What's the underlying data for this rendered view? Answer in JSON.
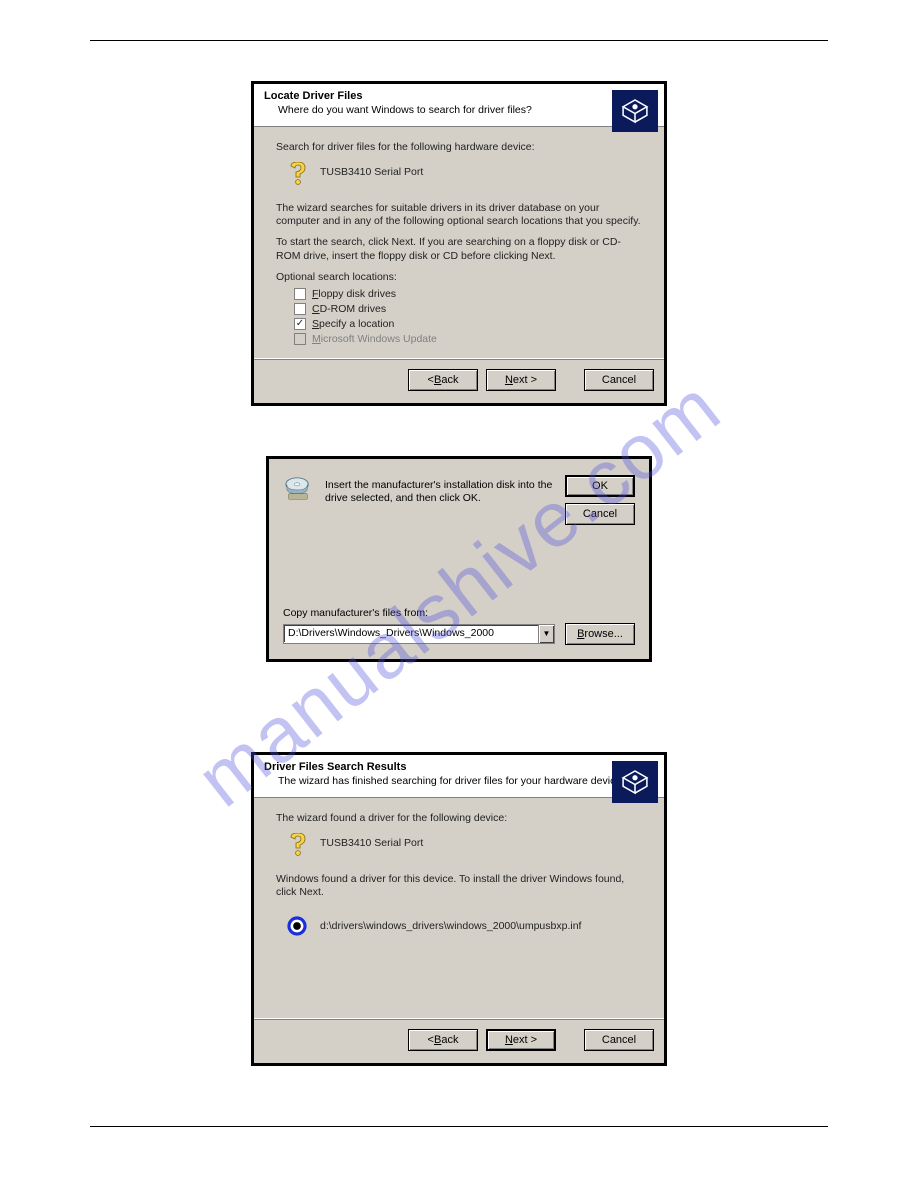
{
  "watermark": "manualshive.com",
  "dialog1": {
    "title": "Locate Driver Files",
    "subtitle": "Where do you want Windows to search for driver files?",
    "search_prompt": "Search for driver files for the following hardware device:",
    "device_name": "TUSB3410 Serial Port",
    "desc1": "The wizard searches for suitable drivers in its driver database on your computer and in any of the following optional search locations that you specify.",
    "desc2": "To start the search, click Next. If you are searching on a floppy disk or CD-ROM drive, insert the floppy disk or CD before clicking Next.",
    "opt_label": "Optional search locations:",
    "checkboxes": [
      {
        "text_pre": "",
        "u": "F",
        "text_post": "loppy disk drives",
        "checked": false,
        "disabled": false
      },
      {
        "text_pre": "",
        "u": "C",
        "text_post": "D-ROM drives",
        "checked": false,
        "disabled": false
      },
      {
        "text_pre": "",
        "u": "S",
        "text_post": "pecify a location",
        "checked": true,
        "disabled": false
      },
      {
        "text_pre": "",
        "u": "M",
        "text_post": "icrosoft Windows Update",
        "checked": false,
        "disabled": true
      }
    ],
    "buttons": {
      "back_u": "B",
      "back_rest": "ack",
      "back_lt": "< ",
      "next_u": "N",
      "next_rest": "ext >",
      "cancel": "Cancel"
    }
  },
  "dialog2": {
    "message": "Insert the manufacturer's installation disk into the drive selected, and then click OK.",
    "ok": "OK",
    "cancel": "Cancel",
    "copy_label_pre": "",
    "copy_label_u": "C",
    "copy_label_post": "opy manufacturer's files from:",
    "path": "D:\\Drivers\\Windows_Drivers\\Windows_2000",
    "browse_u": "B",
    "browse_rest": "rowse..."
  },
  "dialog3": {
    "title": "Driver Files Search Results",
    "subtitle": "The wizard has finished searching for driver files for your hardware device.",
    "found_prompt": "The wizard found a driver for the following device:",
    "device_name": "TUSB3410 Serial Port",
    "install_prompt": "Windows found a driver for this device. To install the driver Windows found, click Next.",
    "inf_path": "d:\\drivers\\windows_drivers\\windows_2000\\umpusbxp.inf",
    "buttons": {
      "back_u": "B",
      "back_rest": "ack",
      "back_lt": "< ",
      "next_u": "N",
      "next_rest": "ext >",
      "cancel": "Cancel"
    }
  }
}
